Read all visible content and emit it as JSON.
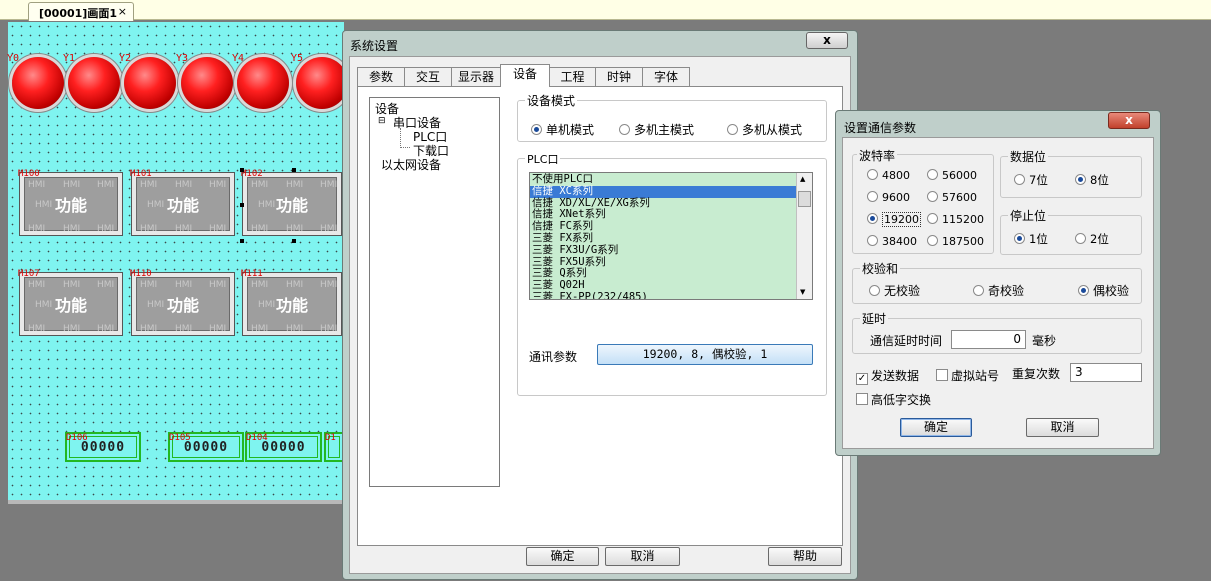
{
  "document_tab": {
    "label": "[00001]画面1",
    "close": "×"
  },
  "canvas": {
    "lamps": [
      "Y0",
      "Y1",
      "Y2",
      "Y3",
      "Y4",
      "Y5"
    ],
    "func_buttons": [
      {
        "id": "M100",
        "label": "功能"
      },
      {
        "id": "M101",
        "label": "功能"
      },
      {
        "id": "M102",
        "label": "功能"
      },
      {
        "id": "M107",
        "label": "功能"
      },
      {
        "id": "M110",
        "label": "功能"
      },
      {
        "id": "M111",
        "label": "功能"
      }
    ],
    "watermark": "HMI",
    "num_displays": [
      {
        "id": "D106",
        "value": "00000"
      },
      {
        "id": "D105",
        "value": "00000"
      },
      {
        "id": "D104",
        "value": "00000"
      },
      {
        "id": "D1",
        "value": ""
      }
    ]
  },
  "sys_dialog": {
    "title": "系统设置",
    "close": "x",
    "tabs": [
      "参数",
      "交互",
      "显示器",
      "设备",
      "工程",
      "时钟",
      "字体"
    ],
    "active_tab": "设备",
    "tree": {
      "root": "设备",
      "serial": "串口设备",
      "plc": "PLC口",
      "download": "下载口",
      "ethernet": "以太网设备"
    },
    "device_mode": {
      "label": "设备模式",
      "options": [
        "单机模式",
        "多机主模式",
        "多机从模式"
      ],
      "selected": "单机模式"
    },
    "plc_port": {
      "label": "PLC口",
      "items": [
        "不使用PLC口",
        "信捷 XC系列",
        "信捷 XD/XL/XE/XG系列",
        "信捷 XNet系列",
        "信捷 FC系列",
        "三菱 FX系列",
        "三菱 FX3U/G系列",
        "三菱 FX5U系列",
        "三菱 Q系列",
        "三菱 Q02H",
        "三菱 FX-PP(232/485)"
      ],
      "selected": "信捷 XC系列"
    },
    "comm_params": {
      "label": "通讯参数",
      "value": "19200, 8, 偶校验, 1"
    },
    "buttons": {
      "ok": "确定",
      "cancel": "取消",
      "help": "帮助"
    }
  },
  "comm_dialog": {
    "title": "设置通信参数",
    "close": "x",
    "baud": {
      "label": "波特率",
      "options": [
        "4800",
        "56000",
        "9600",
        "57600",
        "19200",
        "115200",
        "38400",
        "187500"
      ],
      "selected": "19200"
    },
    "data_bits": {
      "label": "数据位",
      "options": [
        "7位",
        "8位"
      ],
      "selected": "8位"
    },
    "stop_bits": {
      "label": "停止位",
      "options": [
        "1位",
        "2位"
      ],
      "selected": "1位"
    },
    "parity": {
      "label": "校验和",
      "options": [
        "无校验",
        "奇校验",
        "偶校验"
      ],
      "selected": "偶校验"
    },
    "delay": {
      "label": "延时",
      "field_label": "通信延时时间",
      "value": "0",
      "unit": "毫秒"
    },
    "send_data": {
      "label": "发送数据",
      "checked": true
    },
    "virtual_station": {
      "label": "虚拟站号",
      "checked": false
    },
    "retry": {
      "label": "重复次数",
      "value": "3"
    },
    "byte_swap": {
      "label": "高低字交换",
      "checked": false
    },
    "buttons": {
      "ok": "确定",
      "cancel": "取消"
    }
  }
}
